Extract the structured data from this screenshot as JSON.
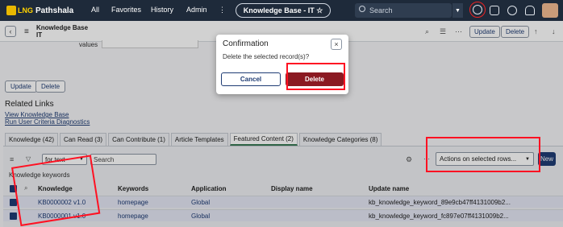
{
  "topnav": {
    "logo_brand": "LNG",
    "logo_name": "Pathshala",
    "links": [
      "All",
      "Favorites",
      "History",
      "Admin"
    ],
    "more": "⋮",
    "context_pill": "Knowledge Base - IT ☆",
    "search_placeholder": "Search"
  },
  "header": {
    "title_line1": "Knowledge Base",
    "title_line2": "IT",
    "update_label": "Update",
    "delete_label": "Delete"
  },
  "form": {
    "values_label": "values"
  },
  "actions_bar": {
    "update_label": "Update",
    "delete_label": "Delete"
  },
  "related": {
    "title": "Related Links",
    "links": [
      "View Knowledge Base",
      "Run User Criteria Diagnostics"
    ]
  },
  "tabs": [
    "Knowledge (42)",
    "Can Read (3)",
    "Can Contribute (1)",
    "Article Templates",
    "Featured Content (2)",
    "Knowledge Categories (8)"
  ],
  "list": {
    "filter_value": "for text",
    "search_placeholder": "Search",
    "actions_label": "Actions on selected rows...",
    "new_label": "New",
    "table_label": "Knowledge keywords",
    "columns": [
      "Knowledge",
      "Keywords",
      "Application",
      "Display name",
      "Update name"
    ],
    "rows": [
      {
        "knowledge": "KB0000002 v1.0",
        "keywords": "homepage",
        "application": "Global",
        "display": "",
        "update": "kb_knowledge_keyword_89e9cb47ff4131009b2..."
      },
      {
        "knowledge": "KB0000001 v1.0",
        "keywords": "homepage",
        "application": "Global",
        "display": "",
        "update": "kb_knowledge_keyword_fc897e07ff4131009b2..."
      }
    ]
  },
  "dialog": {
    "title": "Confirmation",
    "message": "Delete the selected record(s)?",
    "cancel_label": "Cancel",
    "delete_label": "Delete",
    "close": "×"
  },
  "colors": {
    "nav_bg": "#1e2a3a",
    "primary": "#1f3c74",
    "danger": "#8b1a22",
    "annotation": "#ff1122"
  }
}
